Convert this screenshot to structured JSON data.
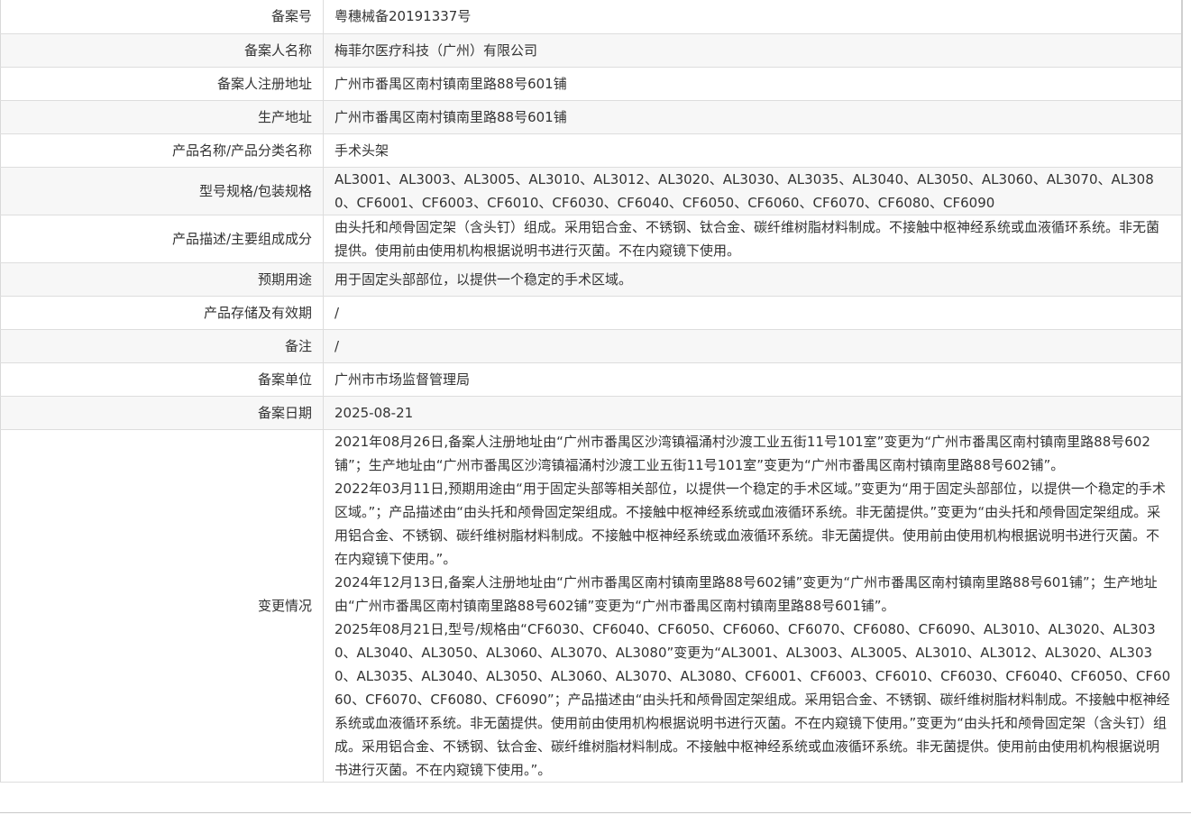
{
  "record": {
    "filing_number": {
      "label": "备案号",
      "value": "粤穗械备20191337号"
    },
    "filer_name": {
      "label": "备案人名称",
      "value": "梅菲尔医疗科技（广州）有限公司"
    },
    "filer_address": {
      "label": "备案人注册地址",
      "value": "广州市番禺区南村镇南里路88号601铺"
    },
    "production_address": {
      "label": "生产地址",
      "value": "广州市番禺区南村镇南里路88号601铺"
    },
    "product_name": {
      "label": "产品名称/产品分类名称",
      "value": "手术头架"
    },
    "model_spec": {
      "label": "型号规格/包装规格",
      "value": "AL3001、AL3003、AL3005、AL3010、AL3012、AL3020、AL3030、AL3035、AL3040、AL3050、AL3060、AL3070、AL3080、CF6001、CF6003、CF6010、CF6030、CF6040、CF6050、CF6060、CF6070、CF6080、CF6090"
    },
    "description": {
      "label": "产品描述/主要组成成分",
      "value": "由头托和颅骨固定架（含头钉）组成。采用铝合金、不锈钢、钛合金、碳纤维树脂材料制成。不接触中枢神经系统或血液循环系统。非无菌提供。使用前由使用机构根据说明书进行灭菌。不在内窥镜下使用。"
    },
    "intended_use": {
      "label": "预期用途",
      "value": "用于固定头部部位，以提供一个稳定的手术区域。"
    },
    "storage": {
      "label": "产品存储及有效期",
      "value": "/"
    },
    "remarks": {
      "label": "备注",
      "value": "/"
    },
    "filing_unit": {
      "label": "备案单位",
      "value": "广州市市场监督管理局"
    },
    "filing_date": {
      "label": "备案日期",
      "value": "2025-08-21"
    },
    "changes": {
      "label": "变更情况",
      "entries": [
        "2021年08月26日,备案人注册地址由“广州市番禺区沙湾镇福涌村沙渡工业五街11号101室”变更为“广州市番禺区南村镇南里路88号602铺”；生产地址由“广州市番禺区沙湾镇福涌村沙渡工业五街11号101室”变更为“广州市番禺区南村镇南里路88号602铺”。",
        "2022年03月11日,预期用途由“用于固定头部等相关部位，以提供一个稳定的手术区域。”变更为“用于固定头部部位，以提供一个稳定的手术区域。”；产品描述由“由头托和颅骨固定架组成。不接触中枢神经系统或血液循环系统。非无菌提供。”变更为“由头托和颅骨固定架组成。采用铝合金、不锈钢、碳纤维树脂材料制成。不接触中枢神经系统或血液循环系统。非无菌提供。使用前由使用机构根据说明书进行灭菌。不在内窥镜下使用。”。",
        "2024年12月13日,备案人注册地址由“广州市番禺区南村镇南里路88号602铺”变更为“广州市番禺区南村镇南里路88号601铺”；生产地址由“广州市番禺区南村镇南里路88号602铺”变更为“广州市番禺区南村镇南里路88号601铺”。",
        "2025年08月21日,型号/规格由“CF6030、CF6040、CF6050、CF6060、CF6070、CF6080、CF6090、AL3010、AL3020、AL3030、AL3040、AL3050、AL3060、AL3070、AL3080”变更为“AL3001、AL3003、AL3005、AL3010、AL3012、AL3020、AL3030、AL3035、AL3040、AL3050、AL3060、AL3070、AL3080、CF6001、CF6003、CF6010、CF6030、CF6040、CF6050、CF6060、CF6070、CF6080、CF6090”；产品描述由“由头托和颅骨固定架组成。采用铝合金、不锈钢、碳纤维树脂材料制成。不接触中枢神经系统或血液循环系统。非无菌提供。使用前由使用机构根据说明书进行灭菌。不在内窥镜下使用。”变更为“由头托和颅骨固定架（含头钉）组成。采用铝合金、不锈钢、钛合金、碳纤维树脂材料制成。不接触中枢神经系统或血液循环系统。非无菌提供。使用前由使用机构根据说明书进行灭菌。不在内窥镜下使用。”。"
      ]
    }
  }
}
